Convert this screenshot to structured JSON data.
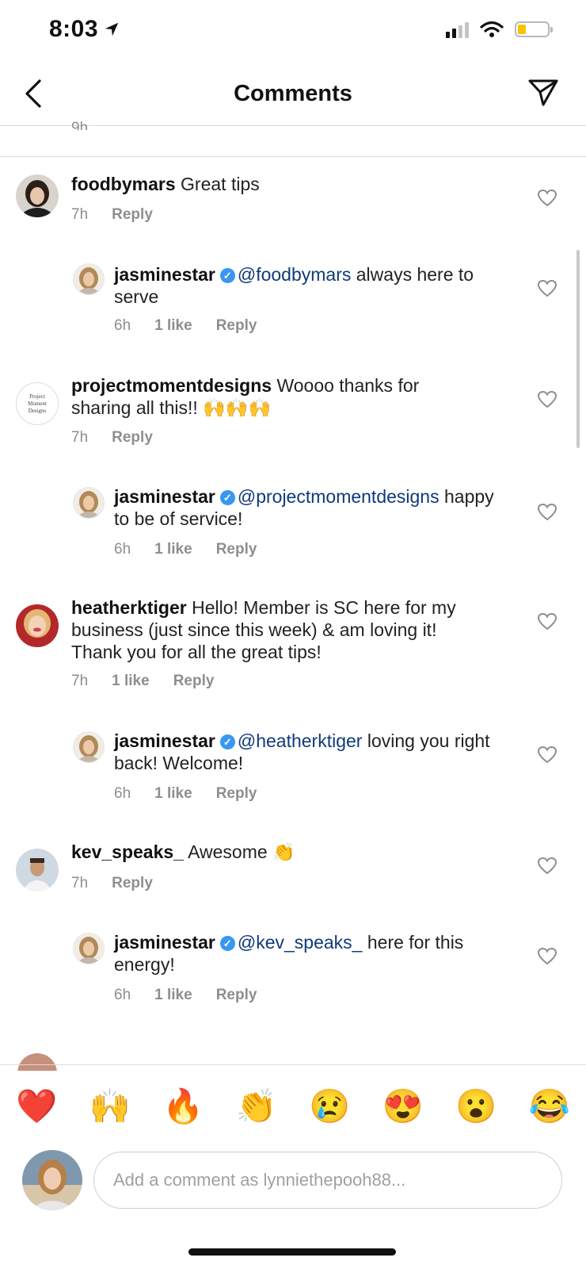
{
  "status_bar": {
    "time": "8:03"
  },
  "header": {
    "title": "Comments"
  },
  "partial_top_meta": "9h",
  "comments": [
    {
      "username": "foodbymars",
      "text": "Great tips",
      "time": "7h",
      "likes": "",
      "reply": "Reply"
    },
    {
      "username": "jasminestar",
      "mention": "@foodbymars",
      "text": "always here to serve",
      "time": "6h",
      "likes": "1 like",
      "reply": "Reply"
    },
    {
      "username": "projectmomentdesigns",
      "text": "Woooo thanks for sharing all this!! 🙌🙌🙌",
      "time": "7h",
      "likes": "",
      "reply": "Reply",
      "avatar_text": "Project Moment Designs"
    },
    {
      "username": "jasminestar",
      "mention": "@projectmomentdesigns",
      "text": "happy to be of service!",
      "time": "6h",
      "likes": "1 like",
      "reply": "Reply"
    },
    {
      "username": "heatherktiger",
      "text": "Hello! Member is SC here for my business (just since this week) & am loving it! Thank you for all the great tips!",
      "time": "7h",
      "likes": "1 like",
      "reply": "Reply"
    },
    {
      "username": "jasminestar",
      "mention": "@heatherktiger",
      "text": "loving you right back! Welcome!",
      "time": "6h",
      "likes": "1 like",
      "reply": "Reply"
    },
    {
      "username": "kev_speaks_",
      "text": "Awesome 👏",
      "time": "7h",
      "likes": "",
      "reply": "Reply"
    },
    {
      "username": "jasminestar",
      "mention": "@kev_speaks_",
      "text": "here for this energy!",
      "time": "6h",
      "likes": "1 like",
      "reply": "Reply"
    }
  ],
  "emoji_bar": [
    "❤️",
    "🙌",
    "🔥",
    "👏",
    "😢",
    "😍",
    "😮",
    "😂"
  ],
  "compose": {
    "placeholder": "Add a comment as lynniethepooh88..."
  },
  "colors": {
    "verified": "#3897f0",
    "mention": "#0f3a7a",
    "meta": "#8e8e8e"
  }
}
